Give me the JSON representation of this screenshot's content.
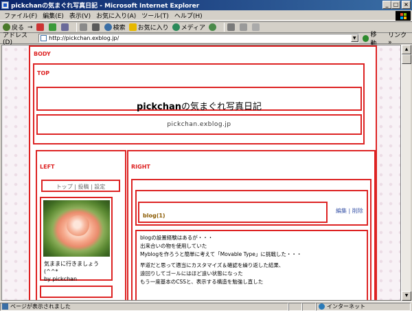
{
  "window": {
    "title": "pickchanの気まぐれ写真日記 - Microsoft Internet Explorer",
    "buttons": [
      "_",
      "□",
      "×"
    ]
  },
  "menubar": [
    "ファイル(F)",
    "編集(E)",
    "表示(V)",
    "お気に入り(A)",
    "ツール(T)",
    "ヘルプ(H)"
  ],
  "toolbar": {
    "back": "戻る",
    "forward": "→",
    "search": "検索",
    "favorites": "お気に入り",
    "media": "メディア"
  },
  "address": {
    "label": "アドレス(D)",
    "url": "http://pickchan.exblog.jp/",
    "go": "移動",
    "links": "リンク »"
  },
  "page": {
    "body_label": "BODY",
    "top_label": "TOP",
    "blog_title_bold": "pickchan",
    "blog_title_rest": "の気まぐれ写真日記",
    "blog_url": "pickchan.exblog.jp",
    "left_label": "LEFT",
    "right_label": "RIGHT",
    "nav": "トップ | 投稿 | 設定",
    "caption_line1": "気ままに行きましょう(^^*",
    "caption_line2": "by pickchan",
    "entry_title": "blog(1)",
    "entry_actions": "編集 | 削除",
    "entry_lines": [
      "blogの設置経験はあるが・・・",
      "出来合いの物を使用していた",
      "Myblogを作ろうと簡単に考えて「Movable Type」に挑戦した・・・",
      "",
      "早道だと思って適当にカスタマイズ＆確認を繰り返した結果、",
      "遠回りしてゴールにはほど遠い状態になった",
      "もう一度基本のCSSと、表示する構造を勉強し直した"
    ]
  },
  "status": {
    "text": "ページが表示されました",
    "zone": "インターネット"
  },
  "colors": {
    "frame": "#dd2222",
    "titlebar": "#0a246a"
  }
}
